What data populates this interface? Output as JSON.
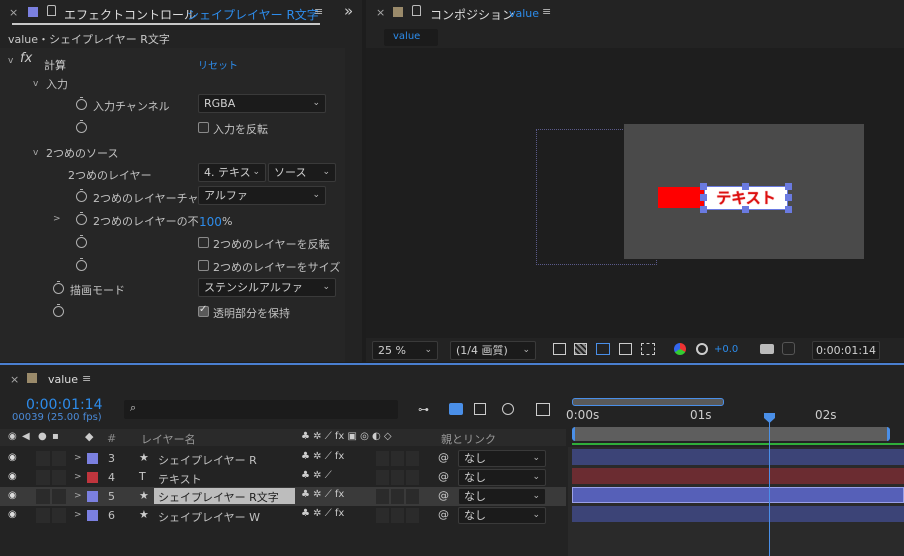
{
  "effect_panel": {
    "tab_label": "エフェクトコントロール",
    "tab_layer": "シェイプレイヤー R文字",
    "breadcrumb": "value・シェイプレイヤー R文字",
    "fx_name": "計算",
    "reset": "リセット",
    "group_input": "入力",
    "input_channel_label": "入力チャンネル",
    "input_channel_value": "RGBA",
    "invert_input": "入力を反転",
    "group_second": "2つめのソース",
    "second_layer_label": "2つめのレイヤー",
    "second_layer_value": "4. テキス",
    "second_layer_mode": "ソース",
    "second_channel_label": "2つめのレイヤーチャ",
    "second_channel_value": "アルファ",
    "second_opacity_label": "2つめのレイヤーの不",
    "second_opacity_value": "100",
    "second_opacity_unit": "%",
    "invert_second": "2つめのレイヤーを反転",
    "stretch_second": "2つめのレイヤーをサイズ",
    "blend_mode_label": "描画モード",
    "blend_mode_value": "ステンシルアルファ",
    "preserve": "透明部分を保持",
    "preserve_checked": true
  },
  "composition": {
    "tab_label": "コンポジション",
    "tab_name": "value",
    "subtab": "value",
    "text_preview": "テキスト",
    "zoom": "25 %",
    "resolution": "(1/4 画質)",
    "exposure": "+0.0",
    "timecode": "0:00:01:14"
  },
  "timeline": {
    "tab": "value",
    "timecode": "0:00:01:14",
    "frame_info": "00039 (25.00 fps)",
    "col_num": "#",
    "col_name": "レイヤー名",
    "col_parent": "親とリンク",
    "ruler": [
      "0:00s",
      "01s",
      "02s"
    ],
    "layers": [
      {
        "num": "3",
        "name": "シェイプレイヤー R",
        "parent": "なし",
        "color": "#7b80e0",
        "type": "star"
      },
      {
        "num": "4",
        "name": "テキスト",
        "parent": "なし",
        "color": "#c0353d",
        "type": "text"
      },
      {
        "num": "5",
        "name": "シェイプレイヤー R文字",
        "parent": "なし",
        "color": "#7b80e0",
        "type": "star"
      },
      {
        "num": "6",
        "name": "シェイプレイヤー W",
        "parent": "なし",
        "color": "#7b80e0",
        "type": "star"
      }
    ]
  }
}
